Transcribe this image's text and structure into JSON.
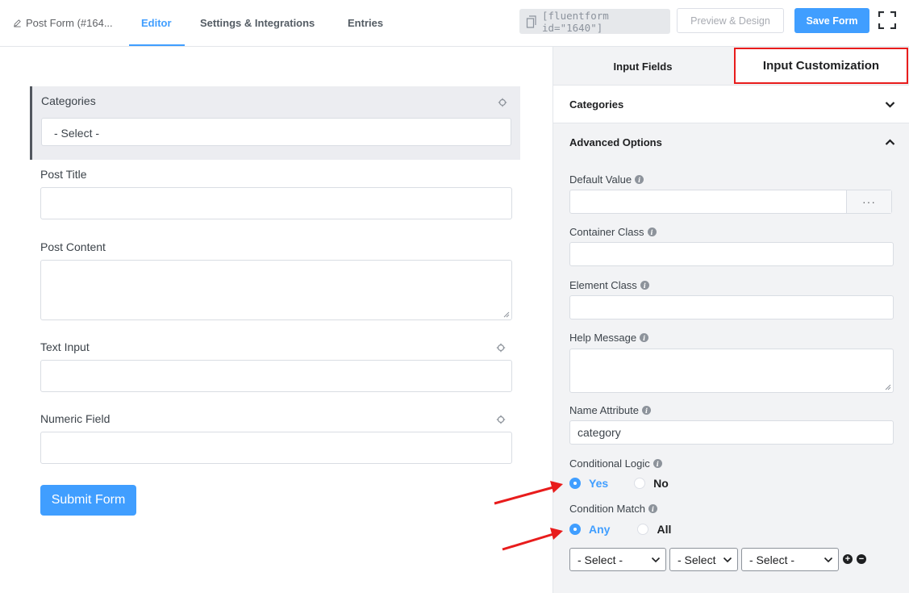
{
  "header": {
    "breadcrumb": "Post Form (#164...",
    "tabs": [
      {
        "label": "Editor",
        "active": true
      },
      {
        "label": "Settings & Integrations",
        "active": false
      },
      {
        "label": "Entries",
        "active": false
      }
    ],
    "shortcode": "[fluentform id=\"1640\"]",
    "preview_label": "Preview & Design",
    "save_label": "Save Form"
  },
  "editor": {
    "fields": [
      {
        "label": "Categories",
        "placeholder": "- Select -"
      },
      {
        "label": "Post Title"
      },
      {
        "label": "Post Content"
      },
      {
        "label": "Text Input"
      },
      {
        "label": "Numeric Field"
      }
    ],
    "submit_label": "Submit Form"
  },
  "sidebar": {
    "tabs": [
      {
        "label": "Input Fields",
        "active": false
      },
      {
        "label": "Input Customization",
        "active": true
      }
    ],
    "sections": [
      {
        "label": "Categories",
        "expanded": false
      },
      {
        "label": "Advanced Options",
        "expanded": true
      }
    ],
    "options": {
      "default_value": {
        "label": "Default Value",
        "value": ""
      },
      "container_class": {
        "label": "Container Class",
        "value": ""
      },
      "element_class": {
        "label": "Element Class",
        "value": ""
      },
      "help_message": {
        "label": "Help Message",
        "value": ""
      },
      "name_attribute": {
        "label": "Name Attribute",
        "value": "category"
      },
      "conditional_logic": {
        "label": "Conditional Logic",
        "options": [
          "Yes",
          "No"
        ],
        "selected": "Yes"
      },
      "condition_match": {
        "label": "Condition Match",
        "options": [
          "Any",
          "All"
        ],
        "selected": "Any"
      },
      "condition_row": [
        "- Select -",
        "- Select",
        "- Select -"
      ]
    }
  },
  "colors": {
    "accent": "#409eff",
    "highlight_border": "#e81c1c",
    "annotation_arrow": "#e81c1c"
  }
}
